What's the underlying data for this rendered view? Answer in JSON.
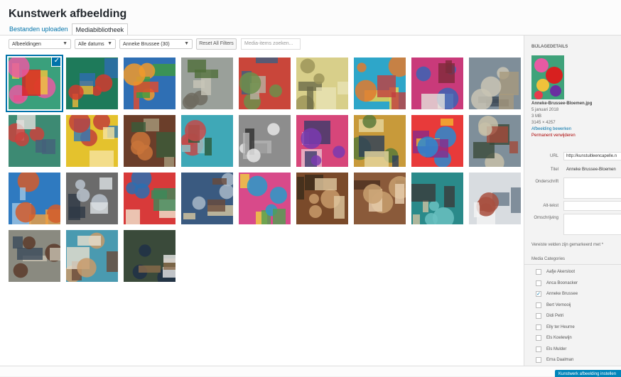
{
  "modal": {
    "title": "Kunstwerk afbeelding",
    "tabs": [
      "Bestanden uploaden",
      "Mediabibliotheek"
    ],
    "active_tab": 1
  },
  "toolbar": {
    "filter_type": "Afbeeldingen",
    "filter_date": "Alle datums",
    "filter_category": "Anneke Brussee (30)",
    "reset_label": "Reset All Filters",
    "search_placeholder": "Media-items zoeken..."
  },
  "grid": {
    "count": 30,
    "selected_index": 0,
    "items": [
      {
        "alt": "flowers-painting"
      },
      {
        "alt": "river-landscape"
      },
      {
        "alt": "sunset-landscape"
      },
      {
        "alt": "barn-painting"
      },
      {
        "alt": "red-house"
      },
      {
        "alt": "yellow-room"
      },
      {
        "alt": "abstract-blue"
      },
      {
        "alt": "abstract-red-blue"
      },
      {
        "alt": "building-grey"
      },
      {
        "alt": "houses-laundry"
      },
      {
        "alt": "yellow-red-abstract"
      },
      {
        "alt": "brown-abstract"
      },
      {
        "alt": "teal-vase"
      },
      {
        "alt": "grey-jug"
      },
      {
        "alt": "pink-abstract"
      },
      {
        "alt": "window-abstract"
      },
      {
        "alt": "colorful-abstract"
      },
      {
        "alt": "grey-houses"
      },
      {
        "alt": "junk-boat"
      },
      {
        "alt": "grey-building"
      },
      {
        "alt": "red-building"
      },
      {
        "alt": "town-blue"
      },
      {
        "alt": "colorful-facade"
      },
      {
        "alt": "wooden-door"
      },
      {
        "alt": "brown-door"
      },
      {
        "alt": "teal-door"
      },
      {
        "alt": "laundry-line"
      },
      {
        "alt": "old-door"
      },
      {
        "alt": "blue-shutters"
      },
      {
        "alt": "artist-photo"
      }
    ]
  },
  "details": {
    "heading": "BIJLAGEDETAILS",
    "filename": "Anneke-Brussee-Bloemen.jpg",
    "date": "5 januari 2018",
    "size": "3 MB",
    "dimensions": "3145 × 4257",
    "edit_link": "Afbeelding bewerken",
    "delete_link": "Permanent verwijderen",
    "fields": {
      "url_label": "URL",
      "url_value": "http://kunstuitleencapelle.n",
      "title_label": "Titel",
      "title_value": "Anneke Brussee-Bloemen",
      "caption_label": "Onderschrift",
      "alt_label": "Alt-tekst",
      "description_label": "Omschrijving"
    },
    "required_note": "Vereiste velden zijn gemarkeerd met *",
    "categories_heading": "Media Categories",
    "categories": [
      {
        "label": "Aafje Akersloot",
        "checked": false
      },
      {
        "label": "Anca Boonacker",
        "checked": false
      },
      {
        "label": "Anneke Brussee",
        "checked": true
      },
      {
        "label": "Bert Vernooij",
        "checked": false
      },
      {
        "label": "Didi Petri",
        "checked": false
      },
      {
        "label": "Elly ter Heurne",
        "checked": false
      },
      {
        "label": "Els Koelewijn",
        "checked": false
      },
      {
        "label": "Els Mulder",
        "checked": false
      },
      {
        "label": "Erna Daalman",
        "checked": false
      }
    ]
  },
  "footer": {
    "insert_label": "Kunstwerk afbeelding instellen"
  },
  "colors": {
    "accent": "#0073aa",
    "primary_button": "#0085ba",
    "delete": "#a00"
  }
}
